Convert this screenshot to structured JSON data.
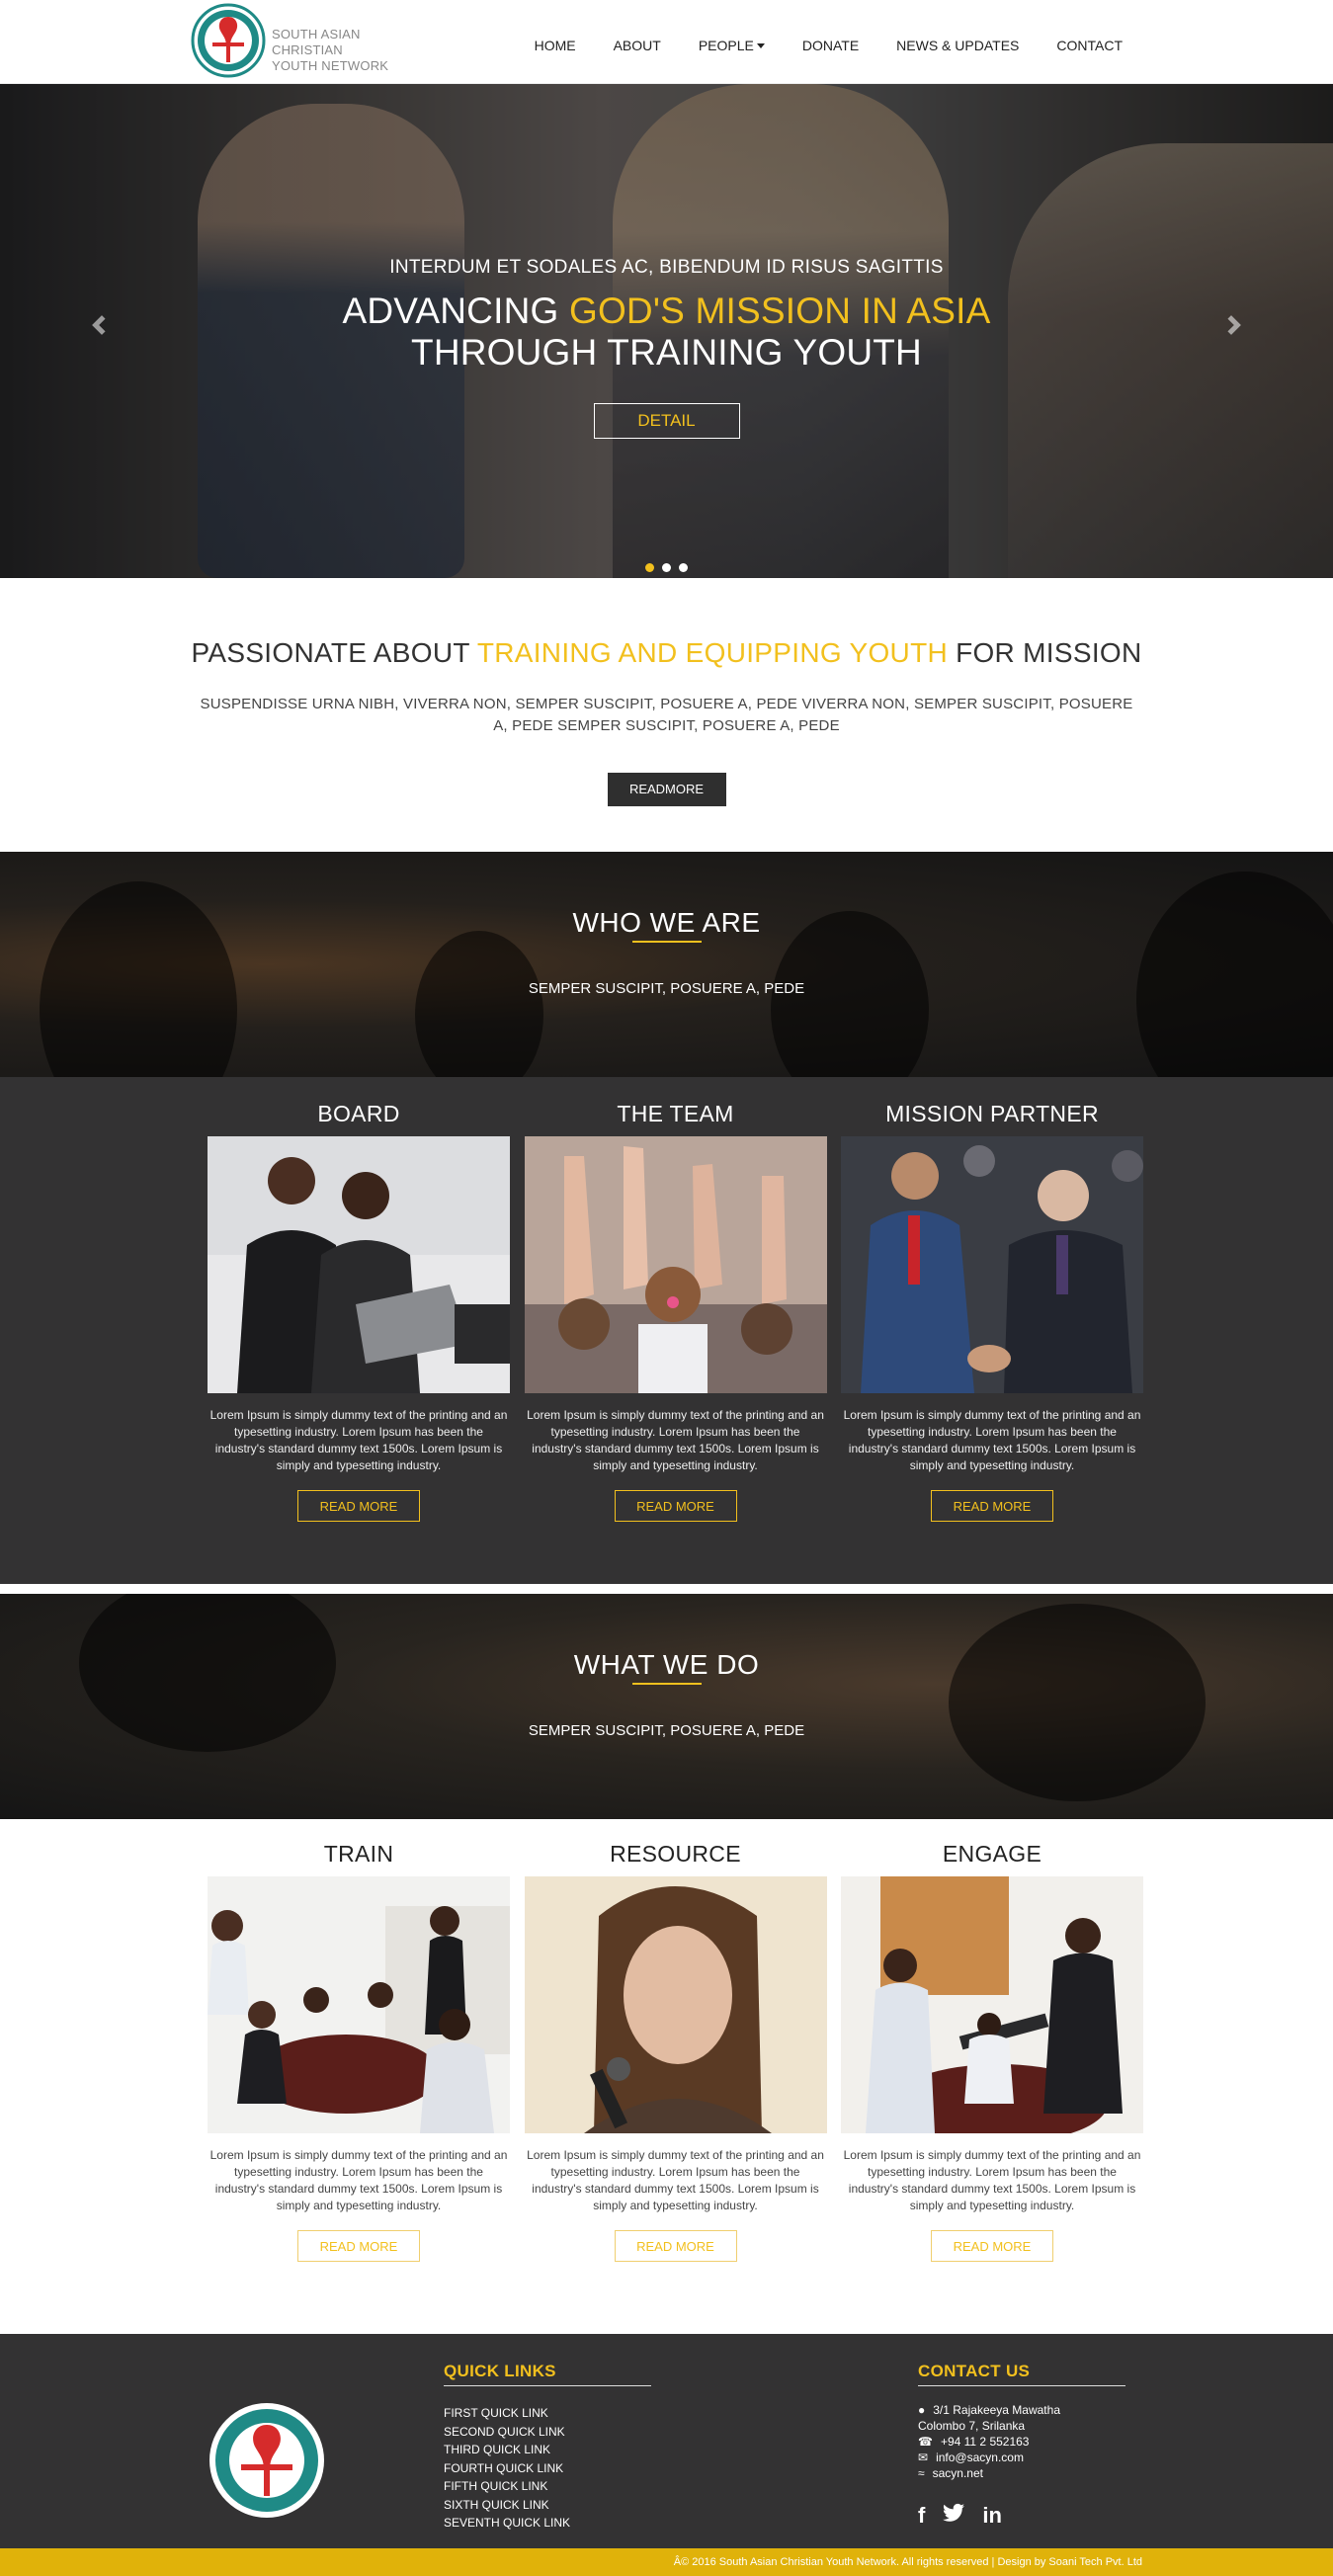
{
  "header": {
    "brand_line1": "SOUTH ASIAN CHRISTIAN",
    "brand_line2": "YOUTH NETWORK",
    "nav": [
      {
        "label": "HOME"
      },
      {
        "label": "ABOUT"
      },
      {
        "label": "PEOPLE"
      },
      {
        "label": "DONATE"
      },
      {
        "label": "NEWS & UPDATES"
      },
      {
        "label": "CONTACT"
      }
    ]
  },
  "hero": {
    "subtitle": "INTERDUM ET SODALES AC, BIBENDUM ID RISUS SAGITTIS",
    "title_pre": "ADVANCING ",
    "title_highlight": "GOD'S MISSION IN ASIA",
    "title_line2": "THROUGH TRAINING YOUTH",
    "button": "DETAIL",
    "slides": 3,
    "active_slide": 1
  },
  "passion": {
    "title_pre": "PASSIONATE ABOUT ",
    "title_highlight": "TRAINING AND EQUIPPING YOUTH",
    "title_post": " FOR MISSION",
    "text": "SUSPENDISSE URNA NIBH, VIVERRA NON, SEMPER SUSCIPIT, POSUERE A, PEDE VIVERRA NON, SEMPER SUSCIPIT, POSUERE A, PEDE SEMPER SUSCIPIT, POSUERE A, PEDE",
    "button": "READMORE"
  },
  "who": {
    "title": "WHO WE ARE",
    "subtitle": "SEMPER SUSCIPIT, POSUERE A, PEDE"
  },
  "who_cards": [
    {
      "title": "BOARD",
      "text": "Lorem Ipsum is simply dummy text of the printing and an typesetting industry. Lorem Ipsum has been the industry's standard dummy text 1500s. Lorem Ipsum is simply and typesetting industry.",
      "button": "READ MORE"
    },
    {
      "title": "THE TEAM",
      "text": "Lorem Ipsum is simply dummy text of the printing and an typesetting industry. Lorem Ipsum has been the industry's standard dummy text 1500s. Lorem Ipsum is simply and typesetting industry.",
      "button": "READ MORE"
    },
    {
      "title": "MISSION PARTNER",
      "text": "Lorem Ipsum is simply dummy text of the printing and an typesetting industry. Lorem Ipsum has been the industry's standard dummy text 1500s. Lorem Ipsum is simply and typesetting industry.",
      "button": "READ MORE"
    }
  ],
  "what": {
    "title": "WHAT WE DO",
    "subtitle": "SEMPER SUSCIPIT, POSUERE A, PEDE"
  },
  "what_cards": [
    {
      "title": "TRAIN",
      "text": "Lorem Ipsum is simply dummy text of the printing and an typesetting industry. Lorem Ipsum has been the industry's standard dummy text 1500s. Lorem Ipsum is simply and typesetting industry.",
      "button": "READ MORE"
    },
    {
      "title": "RESOURCE",
      "text": "Lorem Ipsum is simply dummy text of the printing and an typesetting industry. Lorem Ipsum has been the industry's standard dummy text 1500s. Lorem Ipsum is simply and typesetting industry.",
      "button": "READ MORE"
    },
    {
      "title": "ENGAGE",
      "text": "Lorem Ipsum is simply dummy text of the printing and an typesetting industry. Lorem Ipsum has been the industry's standard dummy text 1500s. Lorem Ipsum is simply and typesetting industry.",
      "button": "READ MORE"
    }
  ],
  "footer": {
    "quick_links_title": "QUICK LINKS",
    "quick_links": [
      "FIRST QUICK LINK",
      "SECOND QUICK LINK",
      "THIRD QUICK LINK",
      "FOURTH QUICK LINK",
      "FIFTH QUICK LINK",
      "SIXTH QUICK LINK",
      "SEVENTH QUICK LINK"
    ],
    "contact_title": "CONTACT US",
    "address_line1": "3/1 Rajakeeya Mawatha",
    "address_line2": "Colombo 7, Srilanka",
    "phone": "+94 11 2 552163",
    "email": "info@sacyn.com",
    "website": "sacyn.net",
    "socials": [
      "f",
      "twitter",
      "in"
    ],
    "copyright": "Â© 2016 South Asian Christian Youth Network. All rights reserved | Design by Soani Tech Pvt. Ltd"
  },
  "colors": {
    "accent": "#f2c01e",
    "dark": "#333233",
    "bar": "#e0b20a"
  }
}
